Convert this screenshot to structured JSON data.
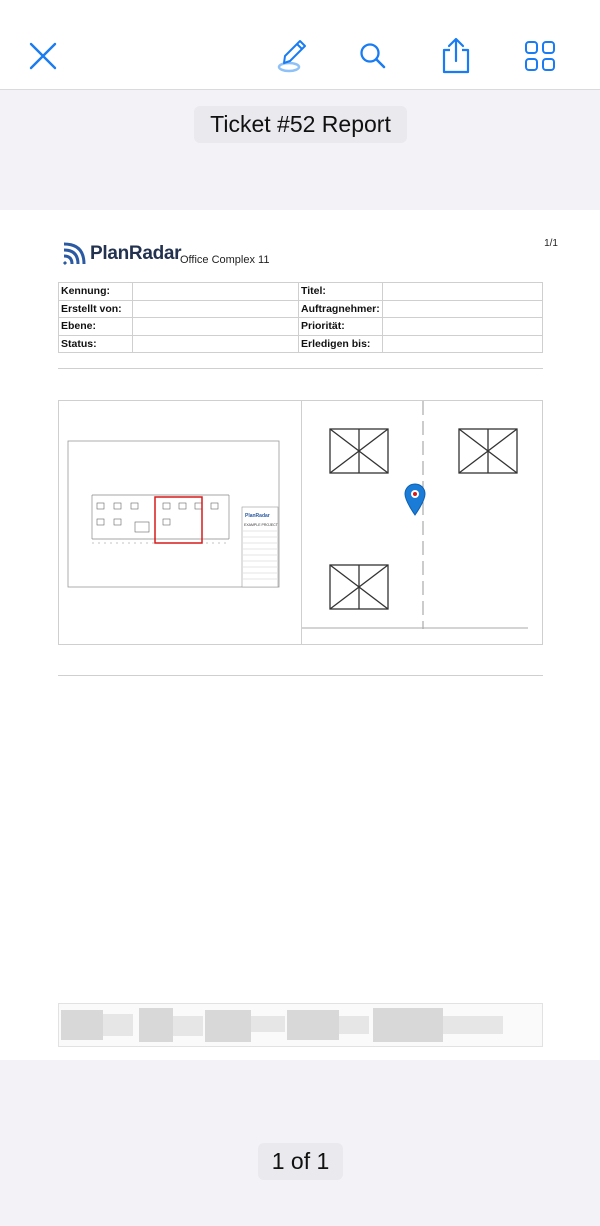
{
  "toolbar": {
    "icons": [
      "close-icon",
      "markup-pen-icon",
      "search-icon",
      "share-icon",
      "grid-icon"
    ],
    "accent_color": "#1a7cf3"
  },
  "document": {
    "title": "Ticket #52 Report"
  },
  "report": {
    "page_number": "1/1",
    "brand": "PlanRadar",
    "project": "Office Complex 11",
    "fields_left": [
      "Kennung:",
      "Erstellt von:",
      "Ebene:",
      "Status:"
    ],
    "fields_right": [
      "Titel:",
      "Auftragnehmer:",
      "Priorität:",
      "Erledigen bis:"
    ],
    "plan_label": "EXAMPLE PROJECT",
    "pin_color": "#1a7cd6"
  },
  "pager": {
    "label": "1 of 1"
  }
}
